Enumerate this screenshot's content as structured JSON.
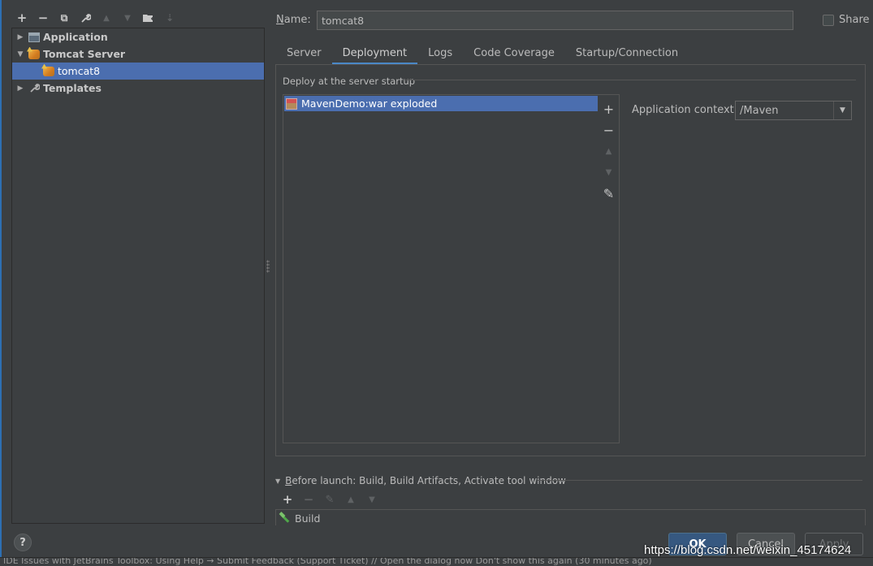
{
  "left_toolbar": {
    "add": "+",
    "remove": "−",
    "copy": "⧉",
    "edit": "🔧",
    "up": "▲",
    "down": "▼",
    "folder": "▆",
    "sort": "⇣"
  },
  "tree": {
    "items": [
      {
        "label": "Application",
        "arrow": "▶"
      },
      {
        "label": "Tomcat Server",
        "arrow": "▼"
      },
      {
        "label": "tomcat8"
      },
      {
        "label": "Templates",
        "arrow": "▶"
      }
    ]
  },
  "form": {
    "name_label_prefix": "N",
    "name_label_rest": "ame:",
    "name_value": "tomcat8",
    "share_label": "Share"
  },
  "tabs": [
    "Server",
    "Deployment",
    "Logs",
    "Code Coverage",
    "Startup/Connection"
  ],
  "deployment": {
    "section_title": "Deploy at the server startup",
    "items": [
      "MavenDemo:war exploded"
    ],
    "app_context_label": "Application context:",
    "app_context_value": "/Maven",
    "side_add": "+",
    "side_remove": "−",
    "side_up": "▲",
    "side_down": "▼",
    "side_edit": "✎"
  },
  "before_launch": {
    "title": "Before launch: Build, Build Artifacts, Activate tool window",
    "title_underline": "B",
    "title_rest": "efore launch: Build, Build Artifacts, Activate tool window",
    "items": [
      "Build"
    ],
    "add": "+",
    "remove": "−",
    "edit": "✎",
    "up": "▲",
    "down": "▼"
  },
  "buttons": {
    "help": "?",
    "ok": "OK",
    "cancel": "Cancel",
    "apply": "Apply"
  },
  "statusbar": {
    "text": "IDE Issues with JetBrains Toolbox: Using Help → Submit Feedback (Support Ticket) // Open the dialog now     Don't show this again (30 minutes ago)"
  },
  "watermark": "https://blog.csdn.net/weixin_45174624",
  "colors": {
    "background": "#3c3f41",
    "selection": "#4b6eaf",
    "tab_underline": "#4a88c7",
    "ok_button": "#365880"
  }
}
